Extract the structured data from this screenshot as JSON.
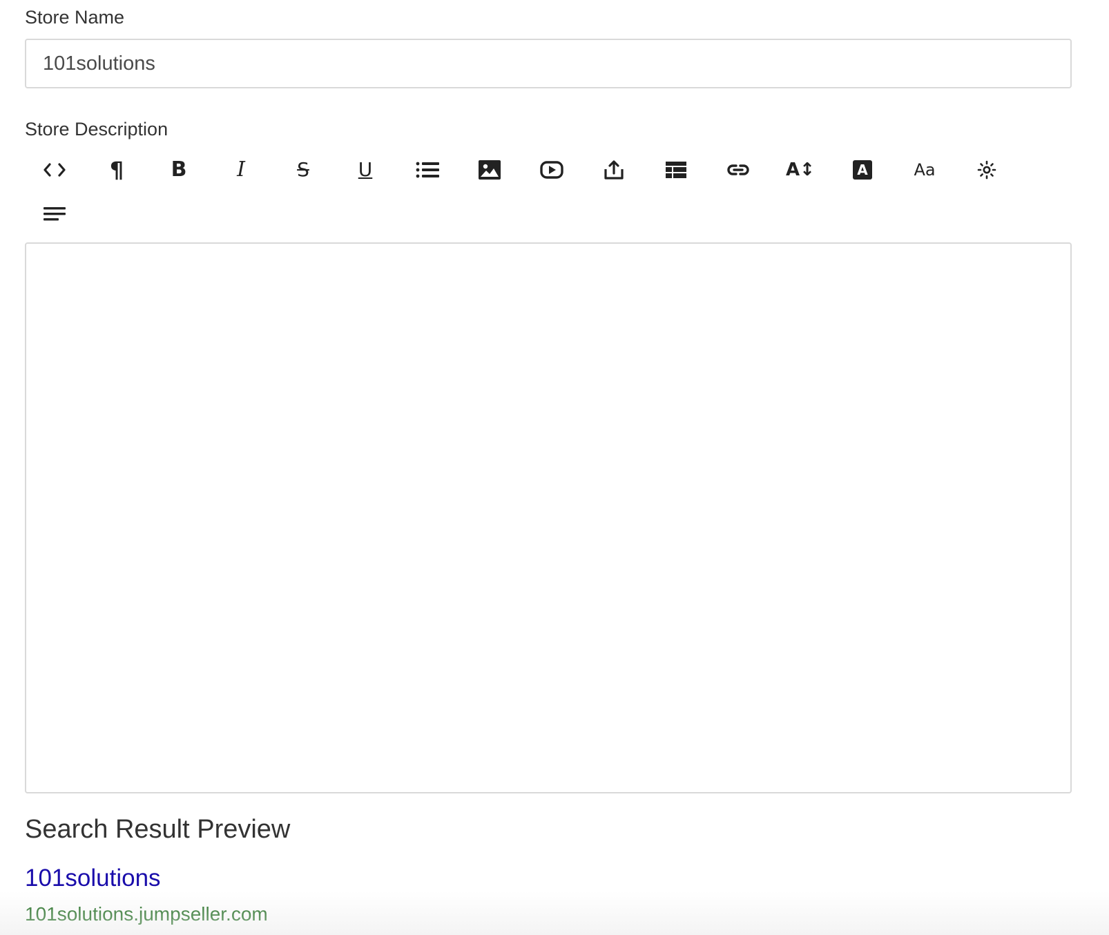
{
  "store_name": {
    "label": "Store Name",
    "value": "101solutions"
  },
  "store_description": {
    "label": "Store Description",
    "toolbar": [
      {
        "name": "html-code-icon",
        "tooltip_glyph": "<>"
      },
      {
        "name": "paragraph-icon",
        "tooltip_glyph": "¶"
      },
      {
        "name": "bold-icon",
        "tooltip_glyph": "B"
      },
      {
        "name": "italic-icon",
        "tooltip_glyph": "I"
      },
      {
        "name": "strikethrough-icon",
        "tooltip_glyph": "S"
      },
      {
        "name": "underline-icon",
        "tooltip_glyph": "U"
      },
      {
        "name": "list-icon"
      },
      {
        "name": "image-icon"
      },
      {
        "name": "video-icon"
      },
      {
        "name": "upload-icon"
      },
      {
        "name": "table-icon"
      },
      {
        "name": "link-icon"
      },
      {
        "name": "font-size-icon",
        "tooltip_glyph": "A↕"
      },
      {
        "name": "font-color-icon",
        "tooltip_glyph": "A"
      },
      {
        "name": "font-family-icon",
        "tooltip_glyph": "Aa"
      },
      {
        "name": "clear-format-icon"
      },
      {
        "name": "align-icon"
      }
    ],
    "content": ""
  },
  "search_preview": {
    "heading": "Search Result Preview",
    "title": "101solutions",
    "url": "101solutions.jumpseller.com"
  },
  "colors": {
    "preview_title": "#1a0dab",
    "preview_url": "#1e6b1e",
    "text": "#333333",
    "border": "#d9d9d9"
  }
}
